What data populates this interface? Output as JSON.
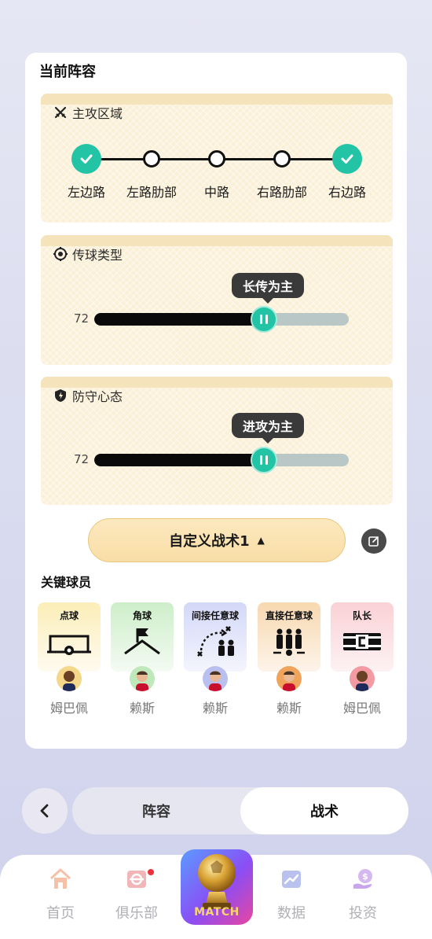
{
  "lineup_card": {
    "title": "当前阵容",
    "attack_zone": {
      "title": "主攻区域",
      "zones": [
        {
          "label": "左边路",
          "selected": true
        },
        {
          "label": "左路肋部",
          "selected": false
        },
        {
          "label": "中路",
          "selected": false
        },
        {
          "label": "右路肋部",
          "selected": false
        },
        {
          "label": "右边路",
          "selected": true
        }
      ]
    },
    "pass_type": {
      "title": "传球类型",
      "value": "72",
      "level_fraction": 0.72,
      "tooltip": "长传为主"
    },
    "defense_mindset": {
      "title": "防守心态",
      "value": "72",
      "level_fraction": 0.72,
      "tooltip": "进攻为主"
    },
    "tactic_button": {
      "label": "自定义战术1",
      "caret": "▲"
    },
    "edit_icon": "edit-icon"
  },
  "key_players": {
    "title": "关键球员",
    "items": [
      {
        "role": "点球",
        "name": "姆巴佩",
        "bg": "#fbf0c4",
        "avatar_bg": "#f5d78a"
      },
      {
        "role": "角球",
        "name": "赖斯",
        "bg": "#d8f2d6",
        "avatar_bg": "#bfe8bb"
      },
      {
        "role": "间接任意球",
        "name": "赖斯",
        "bg": "#dde0fa",
        "avatar_bg": "#b9c0f0"
      },
      {
        "role": "直接任意球",
        "name": "赖斯",
        "bg": "#fbe2c4",
        "avatar_bg": "#f0a35a"
      },
      {
        "role": "队长",
        "name": "姆巴佩",
        "bg": "#fbdde0",
        "avatar_bg": "#f39aa3"
      }
    ]
  },
  "segment": {
    "tabs": [
      {
        "label": "阵容",
        "active": false
      },
      {
        "label": "战术",
        "active": true
      }
    ]
  },
  "tabbar": {
    "items": [
      {
        "label": "首页",
        "icon": "home-icon"
      },
      {
        "label": "俱乐部",
        "icon": "club-icon"
      },
      {
        "label": "MATCH",
        "icon": "trophy-ball-icon"
      },
      {
        "label": "数据",
        "icon": "chart-icon"
      },
      {
        "label": "投资",
        "icon": "money-bag-icon"
      }
    ]
  },
  "colors": {
    "accent": "#23c4a6",
    "panel_bg": "#fbf0d6",
    "button_gold": "#f8dda6"
  }
}
